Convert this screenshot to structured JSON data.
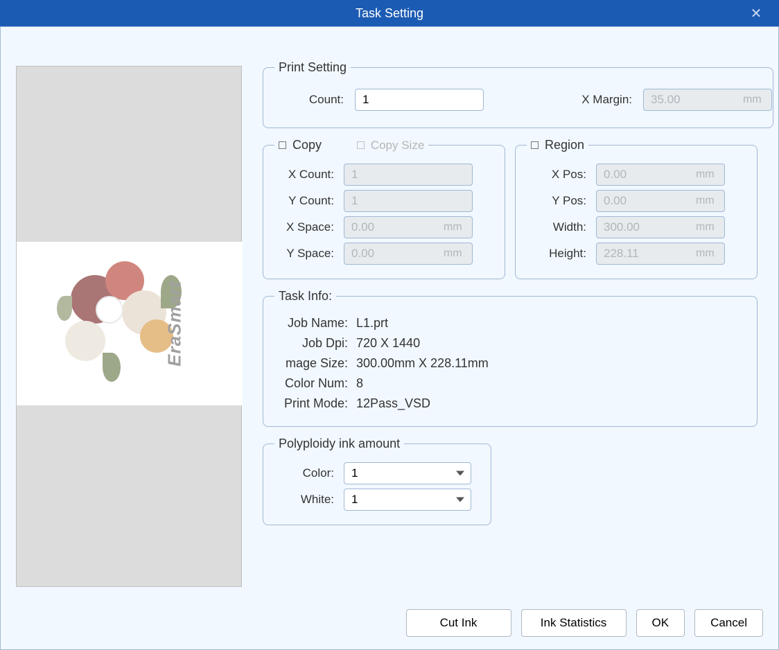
{
  "titlebar": {
    "title": "Task Setting"
  },
  "printSetting": {
    "legend": "Print Setting",
    "count_label": "Count:",
    "count_value": "1",
    "xmargin_label": "X Margin:",
    "xmargin_value": "35.00",
    "xmargin_unit": "mm"
  },
  "copy": {
    "legend": "Copy",
    "copy_size_label": "Copy Size",
    "xcount_label": "X Count:",
    "xcount_value": "1",
    "ycount_label": "Y Count:",
    "ycount_value": "1",
    "xspace_label": "X Space:",
    "xspace_value": "0.00",
    "xspace_unit": "mm",
    "yspace_label": "Y Space:",
    "yspace_value": "0.00",
    "yspace_unit": "mm"
  },
  "region": {
    "legend": "Region",
    "xpos_label": "X Pos:",
    "xpos_value": "0.00",
    "xpos_unit": "mm",
    "ypos_label": "Y Pos:",
    "ypos_value": "0.00",
    "ypos_unit": "mm",
    "width_label": "Width:",
    "width_value": "300.00",
    "width_unit": "mm",
    "height_label": "Height:",
    "height_value": "228.11",
    "height_unit": "mm"
  },
  "taskinfo": {
    "legend": "Task Info:",
    "jobname_label": "Job Name:",
    "jobname_value": "L1.prt",
    "jobdpi_label": "Job Dpi:",
    "jobdpi_value": "720 X 1440",
    "imagesize_label": "mage Size:",
    "imagesize_value": "300.00mm X 228.11mm",
    "colornum_label": "Color Num:",
    "colornum_value": "8",
    "printmode_label": "Print Mode:",
    "printmode_value": "12Pass_VSD"
  },
  "poly": {
    "legend": "Polyploidy ink amount",
    "color_label": "Color:",
    "color_value": "1",
    "white_label": "White:",
    "white_value": "1"
  },
  "buttons": {
    "cutink": "Cut Ink",
    "inkstats": "Ink Statistics",
    "ok": "OK",
    "cancel": "Cancel"
  },
  "preview": {
    "watermark": "EraSmart"
  }
}
